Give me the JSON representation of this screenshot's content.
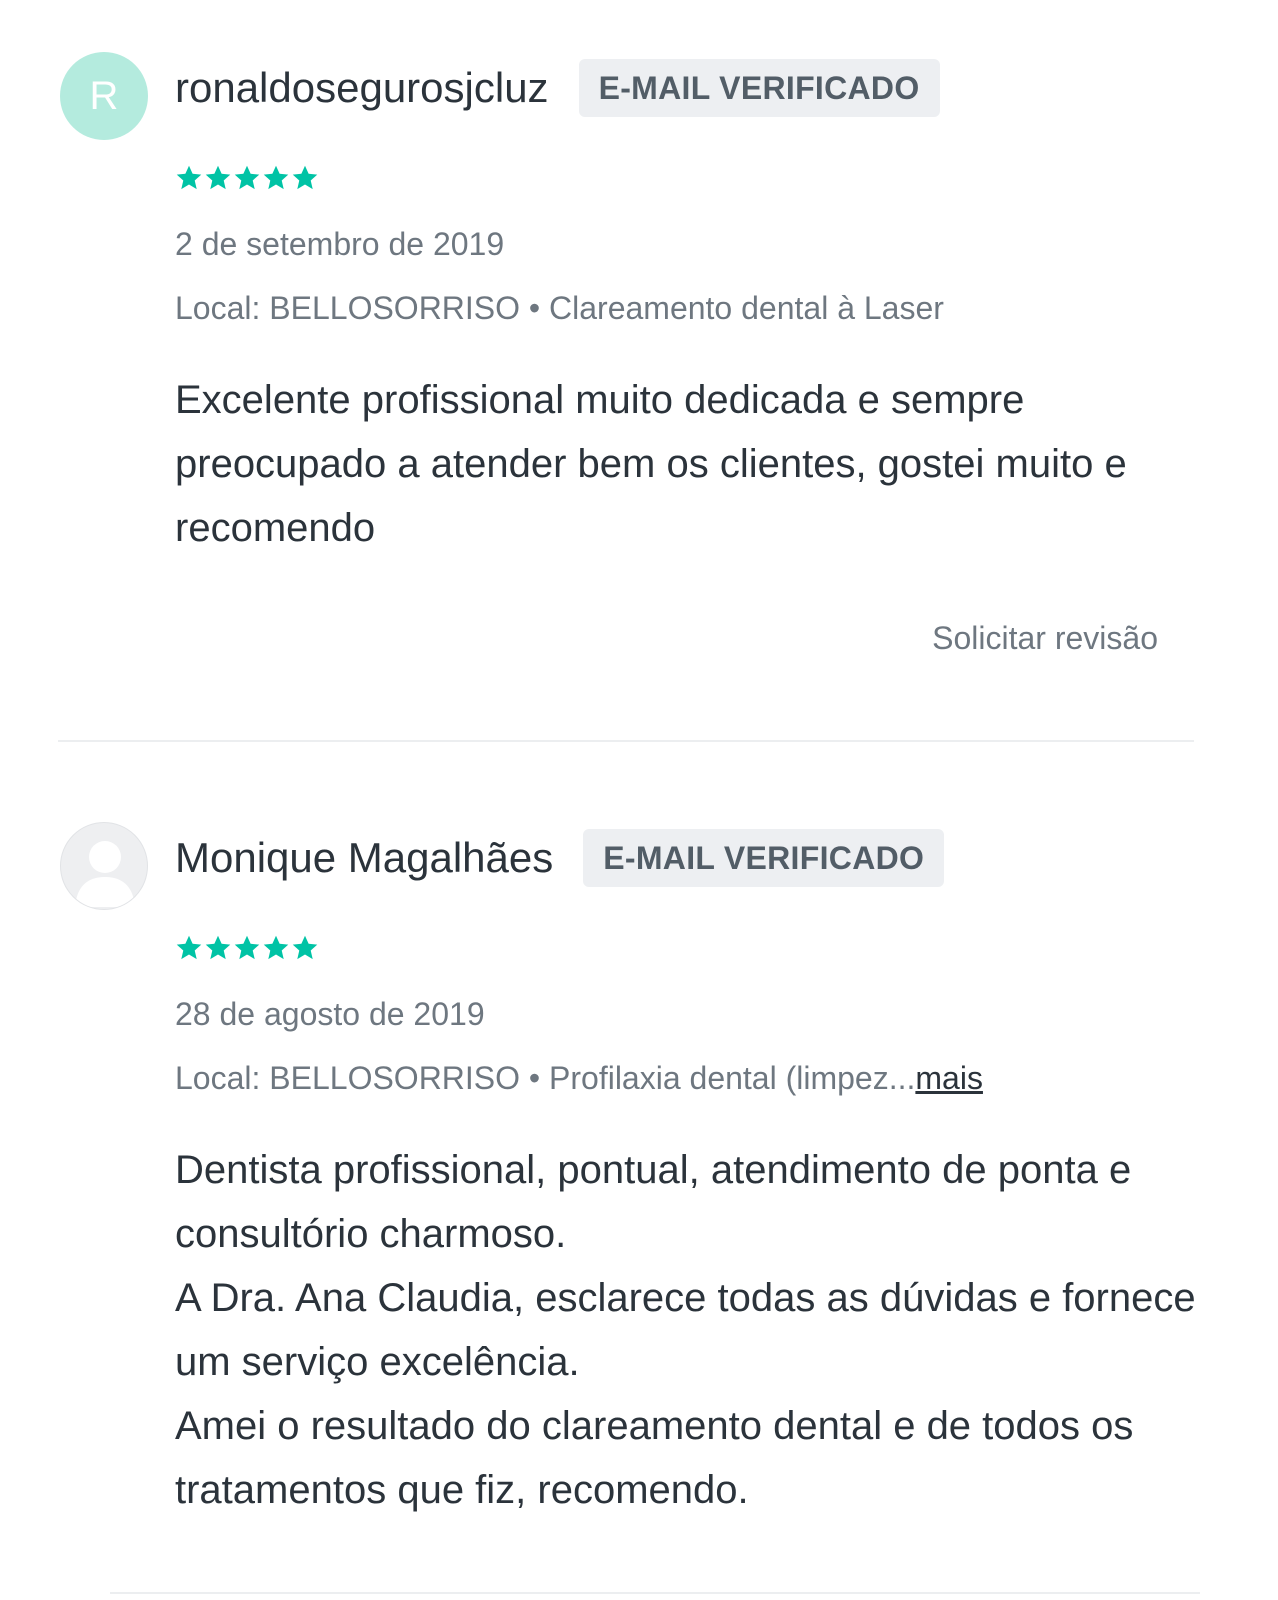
{
  "colors": {
    "accent_star": "#00c3a5",
    "badge_bg": "#edeff2",
    "avatar_letter_bg": "#b4ebde",
    "text_primary": "#2b333b",
    "text_secondary": "#6e7780"
  },
  "reviews": [
    {
      "avatar_letter": "R",
      "avatar_icon": "letter-avatar",
      "username": "ronaldosegurosjcluz",
      "badge": "E-MAIL VERIFICADO",
      "rating": 5,
      "rating_max": 5,
      "date": "2 de setembro de 2019",
      "location_prefix": "Local: BELLOSORRISO",
      "location_sep": " • ",
      "location_service": "Clareamento dental à Laser",
      "body": [
        "Excelente profissional muito dedicada e sempre preocupado a atender bem os clientes, gostei muito e recomendo"
      ],
      "request_review": "Solicitar revisão"
    },
    {
      "avatar_icon": "default-user-icon",
      "username": "Monique Magalhães",
      "badge": "E-MAIL VERIFICADO",
      "rating": 5,
      "rating_max": 5,
      "date": "28 de agosto de 2019",
      "location_prefix": "Local: BELLOSORRISO",
      "location_sep": " • ",
      "location_service": "Profilaxia dental (limpez...",
      "location_more": "mais",
      "body": [
        "Dentista profissional, pontual, atendimento de ponta e consultório charmoso.",
        "A Dra. Ana Claudia, esclarece todas as dúvidas e fornece um serviço excelência.",
        "Amei o resultado do clareamento dental e de todos os tratamentos que fiz, recomendo."
      ]
    }
  ]
}
